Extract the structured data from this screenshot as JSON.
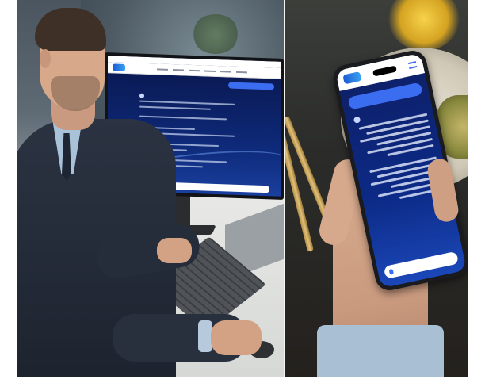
{
  "image": {
    "left_scene": "office",
    "right_scene": "phone"
  }
}
